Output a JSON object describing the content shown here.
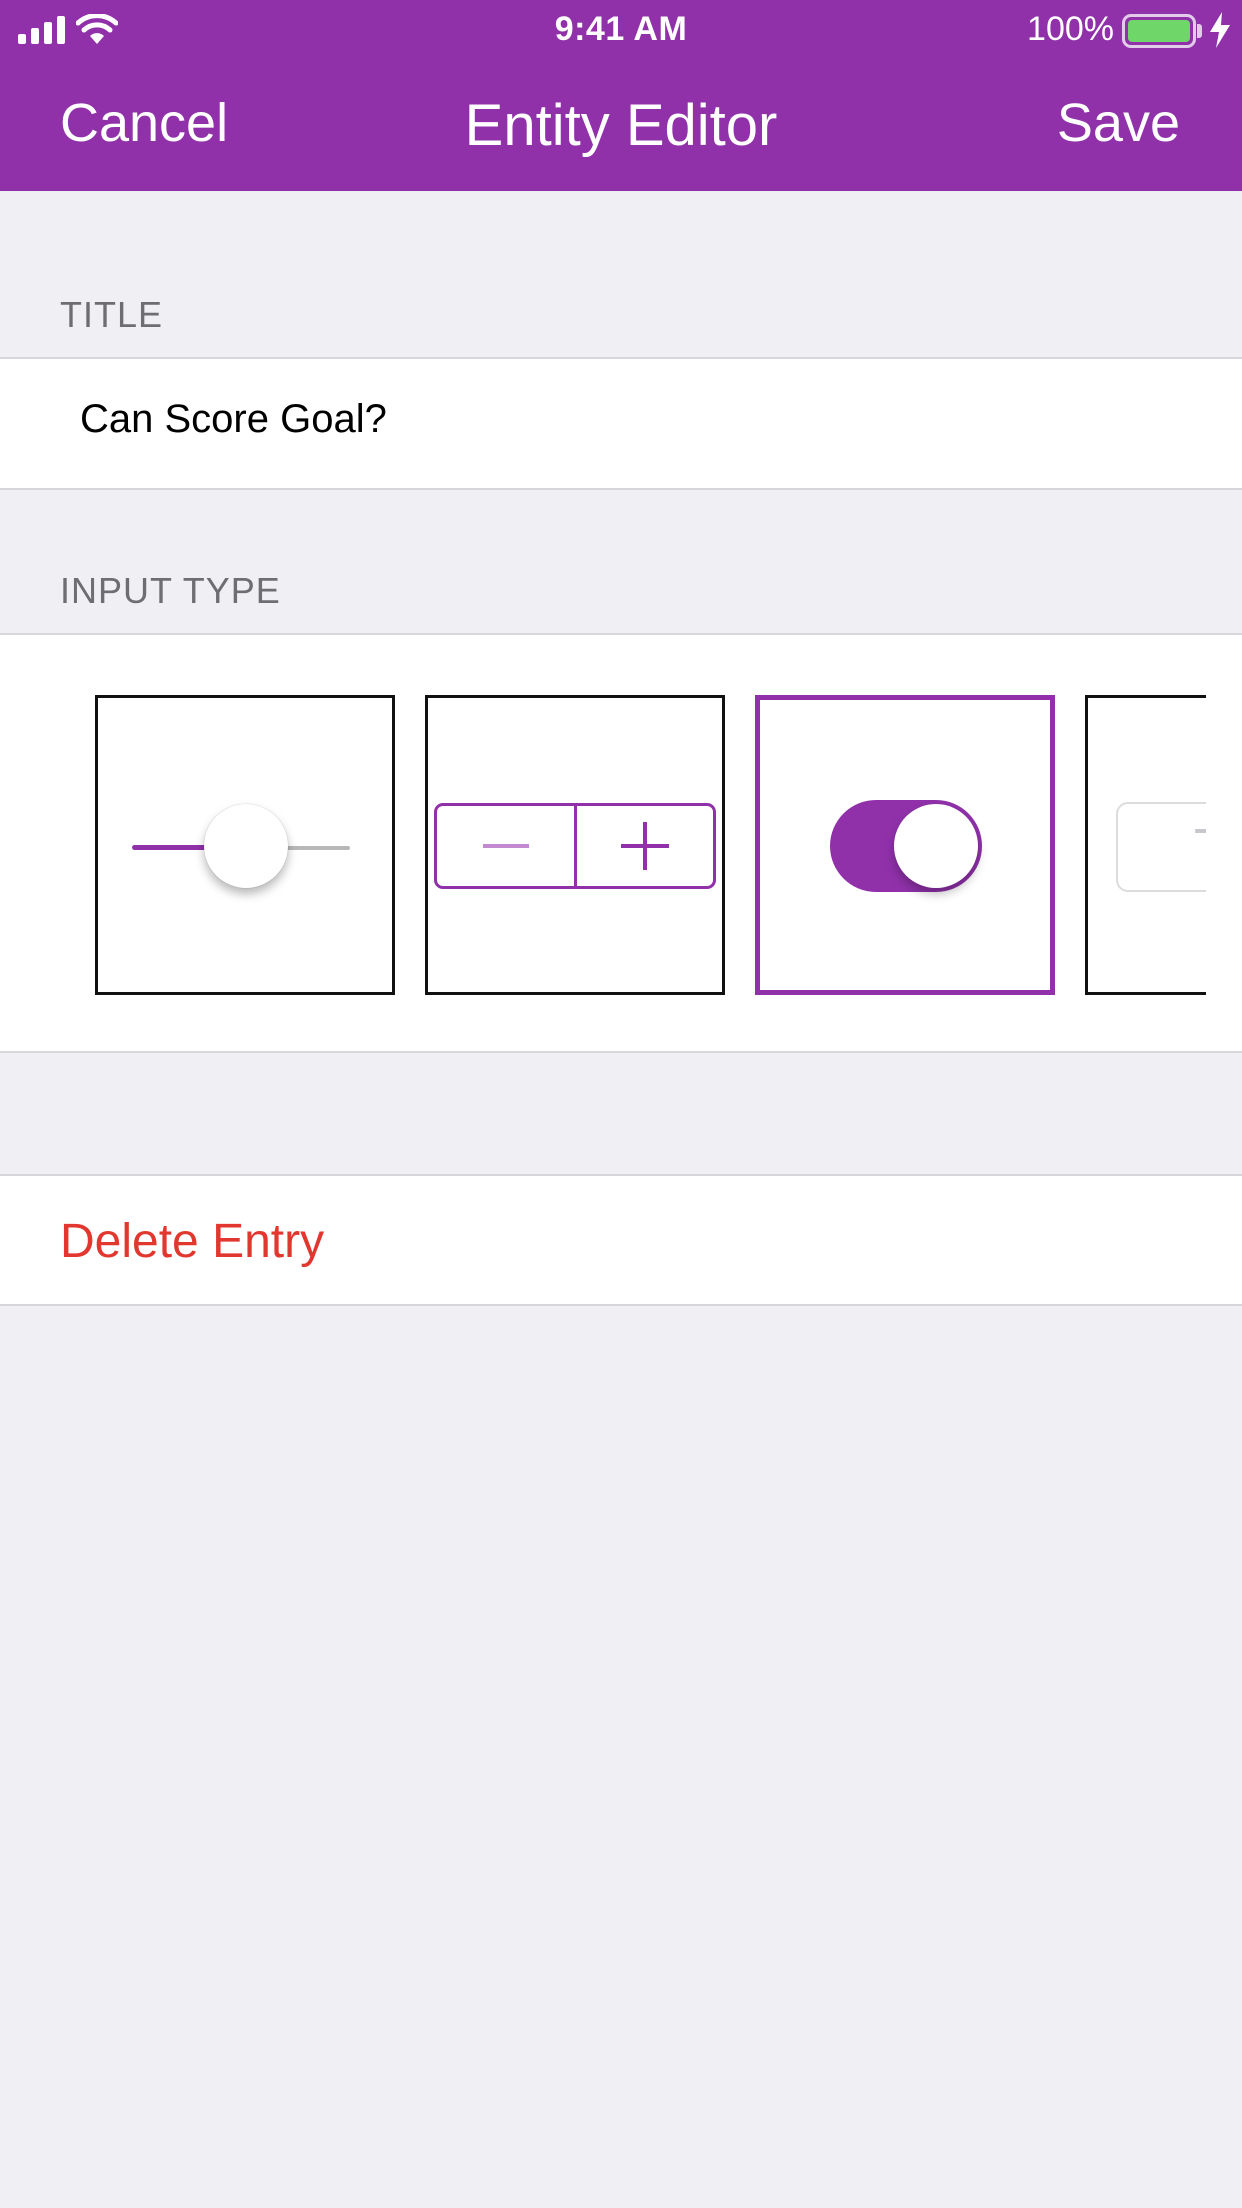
{
  "status_bar": {
    "time": "9:41 AM",
    "battery_percent": "100%",
    "battery_level": 1.0,
    "icons": [
      "signal-icon",
      "wifi-icon",
      "battery-icon",
      "charging-bolt-icon"
    ]
  },
  "nav": {
    "cancel_label": "Cancel",
    "title": "Entity Editor",
    "save_label": "Save"
  },
  "title_section": {
    "header": "TITLE",
    "value": "Can Score Goal?"
  },
  "input_type_section": {
    "header": "INPUT TYPE",
    "options": [
      {
        "type": "slider",
        "icon": "slider-icon",
        "selected": false
      },
      {
        "type": "stepper",
        "icon": "stepper-icon",
        "selected": false
      },
      {
        "type": "switch",
        "icon": "switch-icon",
        "selected": true
      },
      {
        "type": "text",
        "icon": "text-field-icon",
        "selected": false,
        "preview_text": "T"
      }
    ]
  },
  "delete": {
    "label": "Delete Entry"
  },
  "colors": {
    "accent": "#9031aa",
    "destructive": "#e2372e",
    "background": "#efeff4",
    "battery": "#6fd66a"
  }
}
